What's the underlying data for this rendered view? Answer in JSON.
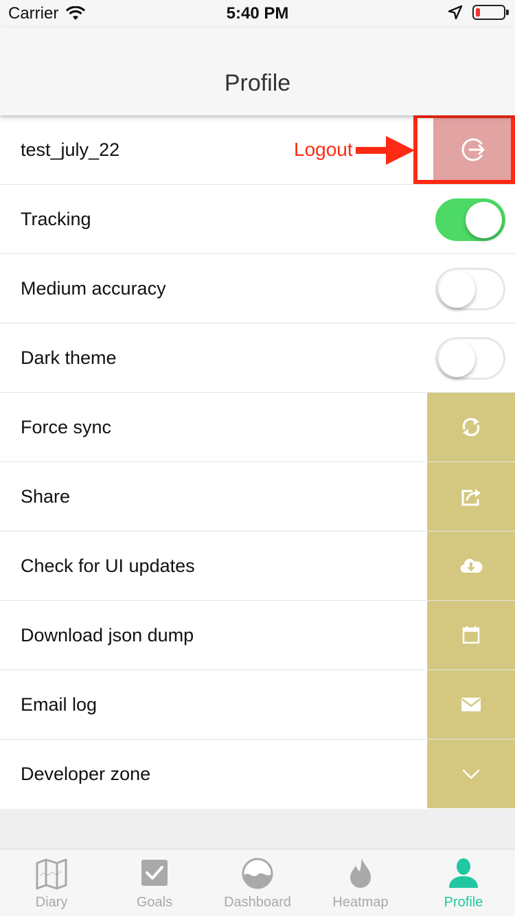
{
  "status_bar": {
    "carrier": "Carrier",
    "time": "5:40 PM"
  },
  "nav": {
    "title": "Profile"
  },
  "colors": {
    "accent": "#1fc8a0",
    "action_bg": "#d4c881",
    "toggle_on": "#4cd964",
    "annotation": "#ff2a14",
    "logout_bg": "#e2a3a3"
  },
  "rows": {
    "user": {
      "label": "test_july_22",
      "annotation": "Logout",
      "icon": "logout-icon"
    },
    "tracking": {
      "label": "Tracking",
      "on": true
    },
    "medium_accuracy": {
      "label": "Medium accuracy",
      "on": false
    },
    "dark_theme": {
      "label": "Dark theme",
      "on": false
    },
    "force_sync": {
      "label": "Force sync",
      "icon": "sync-icon"
    },
    "share": {
      "label": "Share",
      "icon": "share-icon"
    },
    "ui_updates": {
      "label": "Check for UI updates",
      "icon": "cloud-download-icon"
    },
    "json_dump": {
      "label": "Download json dump",
      "icon": "calendar-icon"
    },
    "email_log": {
      "label": "Email log",
      "icon": "mail-icon"
    },
    "developer_zone": {
      "label": "Developer zone",
      "icon": "chevron-down-icon"
    }
  },
  "tabs": [
    {
      "label": "Diary",
      "icon": "map-icon"
    },
    {
      "label": "Goals",
      "icon": "checkbox-icon"
    },
    {
      "label": "Dashboard",
      "icon": "dashboard-icon"
    },
    {
      "label": "Heatmap",
      "icon": "flame-icon"
    },
    {
      "label": "Profile",
      "icon": "person-icon",
      "active": true
    }
  ]
}
